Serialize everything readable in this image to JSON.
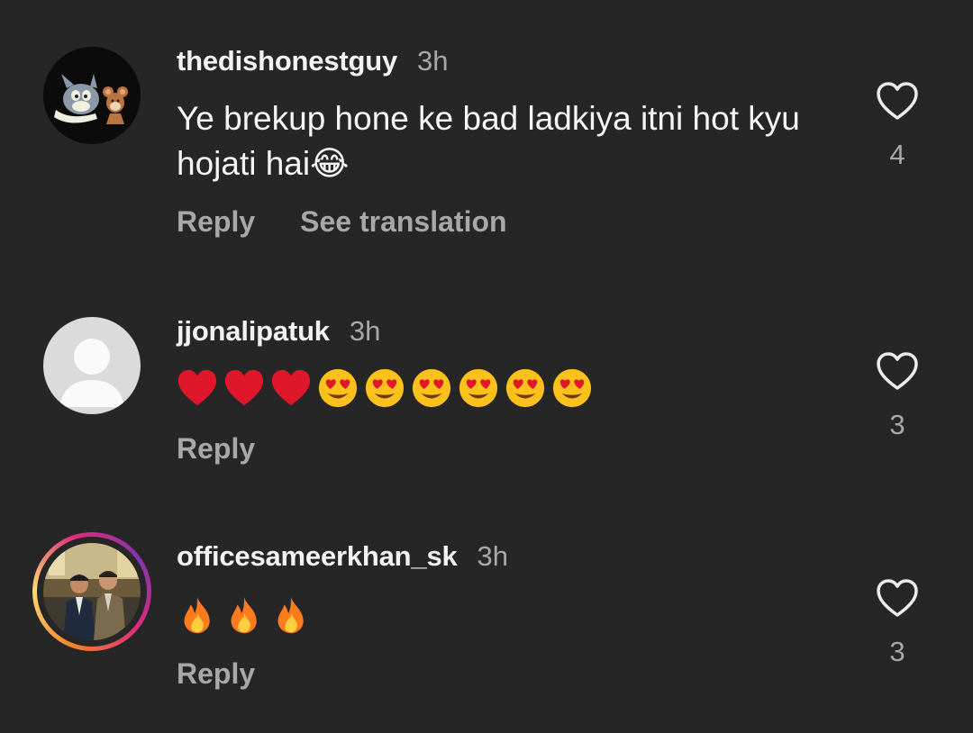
{
  "comments": [
    {
      "username": "thedishonestguy",
      "time": "3h",
      "text": "Ye brekup hone ke bad ladkiya itni hot kyu hojati hai😂",
      "emojis": [],
      "actions": [
        "Reply",
        "See translation"
      ],
      "likes": "4",
      "avatar": "tom-and-jerry-avatar"
    },
    {
      "username": "jjonalipatuk",
      "time": "3h",
      "text": "",
      "emojis": [
        "red-heart",
        "red-heart",
        "red-heart",
        "heart-eyes",
        "heart-eyes",
        "heart-eyes",
        "heart-eyes",
        "heart-eyes",
        "heart-eyes"
      ],
      "actions": [
        "Reply"
      ],
      "likes": "3",
      "avatar": "default-avatar"
    },
    {
      "username": "officesameerkhan_sk",
      "time": "3h",
      "text": "",
      "emojis": [
        "fire",
        "fire",
        "fire"
      ],
      "actions": [
        "Reply"
      ],
      "likes": "3",
      "avatar": "photo-avatar-story-ring"
    }
  ],
  "colors": {
    "background": "#262626",
    "muted": "#a8a8a8",
    "text": "#f5f5f5"
  }
}
